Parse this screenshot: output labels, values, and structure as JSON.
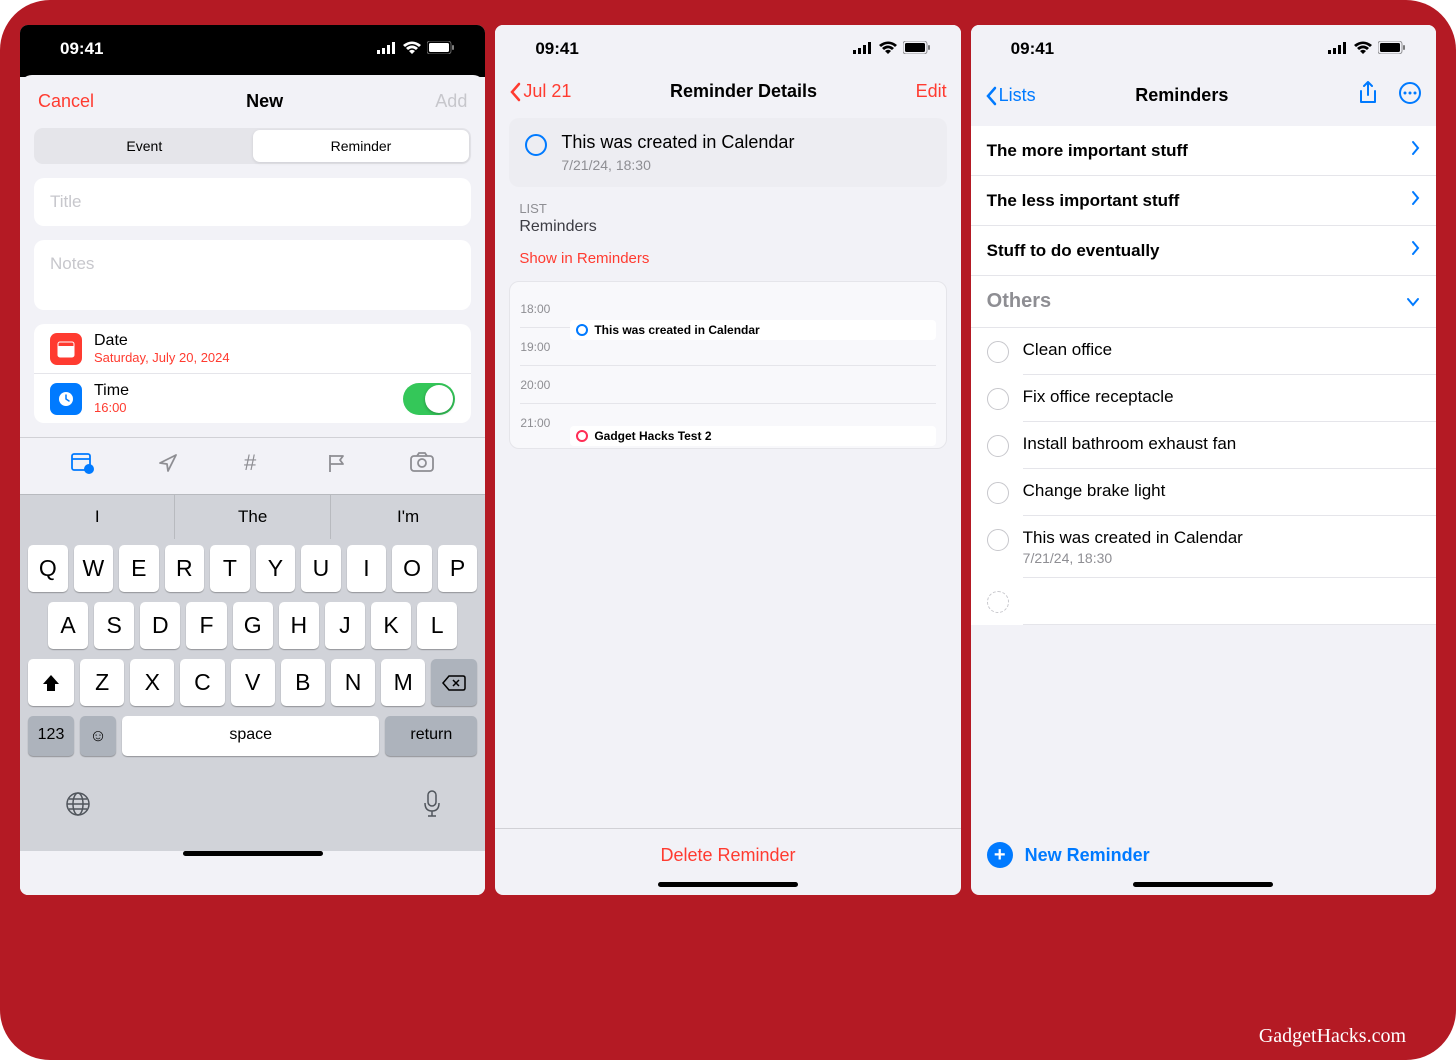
{
  "watermark": "GadgetHacks.com",
  "status": {
    "time": "09:41"
  },
  "phone1": {
    "nav": {
      "cancel": "Cancel",
      "title": "New",
      "add": "Add"
    },
    "seg": {
      "event": "Event",
      "reminder": "Reminder"
    },
    "title_placeholder": "Title",
    "notes_placeholder": "Notes",
    "date": {
      "label": "Date",
      "value": "Saturday, July 20, 2024"
    },
    "time": {
      "label": "Time",
      "value": "16:00"
    },
    "suggestions": [
      "I",
      "The",
      "I'm"
    ],
    "keys_row1": [
      "Q",
      "W",
      "E",
      "R",
      "T",
      "Y",
      "U",
      "I",
      "O",
      "P"
    ],
    "keys_row2": [
      "A",
      "S",
      "D",
      "F",
      "G",
      "H",
      "J",
      "K",
      "L"
    ],
    "keys_row3": [
      "Z",
      "X",
      "C",
      "V",
      "B",
      "N",
      "M"
    ],
    "key_123": "123",
    "key_space": "space",
    "key_return": "return"
  },
  "phone2": {
    "nav": {
      "back": "Jul 21",
      "title": "Reminder Details",
      "edit": "Edit"
    },
    "reminder": {
      "title": "This was created in Calendar",
      "subtitle": "7/21/24, 18:30"
    },
    "list": {
      "header": "LIST",
      "value": "Reminders",
      "show_link": "Show in Reminders"
    },
    "timeline": {
      "hours": [
        "18:00",
        "19:00",
        "20:00",
        "21:00"
      ],
      "event1": "This was created in Calendar",
      "event2": "Gadget Hacks Test 2"
    },
    "delete": "Delete Reminder"
  },
  "phone3": {
    "nav": {
      "back": "Lists",
      "title": "Reminders"
    },
    "lists": [
      "The more important stuff",
      "The less important stuff",
      "Stuff to do eventually"
    ],
    "section": "Others",
    "tasks": [
      {
        "title": "Clean office"
      },
      {
        "title": "Fix office receptacle"
      },
      {
        "title": "Install bathroom exhaust fan"
      },
      {
        "title": "Change brake light"
      },
      {
        "title": "This was created in Calendar",
        "subtitle": "7/21/24, 18:30"
      }
    ],
    "new_reminder": "New Reminder"
  }
}
